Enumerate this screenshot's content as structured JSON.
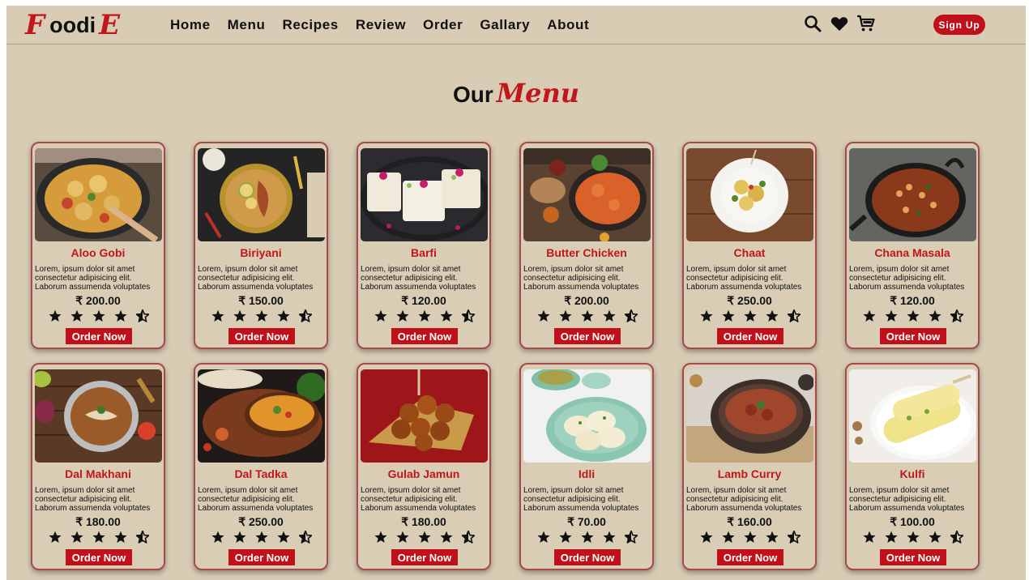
{
  "brand": {
    "first": "F",
    "middle": "oodi",
    "last": "E"
  },
  "nav": {
    "links": [
      "Home",
      "Menu",
      "Recipes",
      "Review",
      "Order",
      "Gallary",
      "About"
    ],
    "icons": [
      "search-icon",
      "heart-icon",
      "cart-icon"
    ],
    "signup_label": "Sign Up"
  },
  "section": {
    "title_plain": "Our",
    "title_accent": "Menu"
  },
  "colors": {
    "background": "#d8ccb4",
    "accent": "#c0161c",
    "button": "#c0101a",
    "card_border": "#a5494a"
  },
  "menu": {
    "items": [
      {
        "name": "Aloo Gobi",
        "desc": [
          "Lorem, ipsum dolor sit amet",
          "consectetur adipisicing elit.",
          "Laborum assumenda voluptates"
        ],
        "price": "₹ 200.00",
        "rating": 4.5,
        "order_label": "Order Now",
        "image": "aloo-gobi-image"
      },
      {
        "name": "Biriyani",
        "desc": [
          "Lorem, ipsum dolor sit amet",
          "consectetur adipisicing elit.",
          "Laborum assumenda voluptates"
        ],
        "price": "₹ 150.00",
        "rating": 4.5,
        "order_label": "Order Now",
        "image": "biriyani-image"
      },
      {
        "name": "Barfi",
        "desc": [
          "Lorem, ipsum dolor sit amet",
          "consectetur adipisicing elit.",
          "Laborum assumenda voluptates"
        ],
        "price": "₹ 120.00",
        "rating": 4.5,
        "order_label": "Order Now",
        "image": "barfi-image"
      },
      {
        "name": "Butter Chicken",
        "desc": [
          "Lorem, ipsum dolor sit amet",
          "consectetur adipisicing elit.",
          "Laborum assumenda voluptates"
        ],
        "price": "₹ 200.00",
        "rating": 4.5,
        "order_label": "Order Now",
        "image": "butter-chicken-image"
      },
      {
        "name": "Chaat",
        "desc": [
          "Lorem, ipsum dolor sit amet",
          "consectetur adipisicing elit.",
          "Laborum assumenda voluptates"
        ],
        "price": "₹ 250.00",
        "rating": 4.5,
        "order_label": "Order Now",
        "image": "chaat-image"
      },
      {
        "name": "Chana Masala",
        "desc": [
          "Lorem, ipsum dolor sit amet",
          "consectetur adipisicing elit.",
          "Laborum assumenda voluptates"
        ],
        "price": "₹ 120.00",
        "rating": 4.5,
        "order_label": "Order Now",
        "image": "chana-masala-image"
      },
      {
        "name": "Dal Makhani",
        "desc": [
          "Lorem, ipsum dolor sit amet",
          "consectetur adipisicing elit.",
          "Laborum assumenda voluptates"
        ],
        "price": "₹ 180.00",
        "rating": 4.5,
        "order_label": "Order Now",
        "image": "dal-makhani-image"
      },
      {
        "name": "Dal Tadka",
        "desc": [
          "Lorem, ipsum dolor sit amet",
          "consectetur adipisicing elit.",
          "Laborum assumenda voluptates"
        ],
        "price": "₹ 250.00",
        "rating": 4.5,
        "order_label": "Order Now",
        "image": "dal-tadka-image"
      },
      {
        "name": "Gulab Jamun",
        "desc": [
          "Lorem, ipsum dolor sit amet",
          "consectetur adipisicing elit.",
          "Laborum assumenda voluptates"
        ],
        "price": "₹ 180.00",
        "rating": 4.5,
        "order_label": "Order Now",
        "image": "gulab-jamun-image"
      },
      {
        "name": "Idli",
        "desc": [
          "Lorem, ipsum dolor sit amet",
          "consectetur adipisicing elit.",
          "Laborum assumenda voluptates"
        ],
        "price": "₹ 70.00",
        "rating": 4.5,
        "order_label": "Order Now",
        "image": "idli-image"
      },
      {
        "name": "Lamb Curry",
        "desc": [
          "Lorem, ipsum dolor sit amet",
          "consectetur adipisicing elit.",
          "Laborum assumenda voluptates"
        ],
        "price": "₹ 160.00",
        "rating": 4.5,
        "order_label": "Order Now",
        "image": "lamb-curry-image"
      },
      {
        "name": "Kulfi",
        "desc": [
          "Lorem, ipsum dolor sit amet",
          "consectetur adipisicing elit.",
          "Laborum assumenda voluptates"
        ],
        "price": "₹ 100.00",
        "rating": 4.5,
        "order_label": "Order Now",
        "image": "kulfi-image"
      }
    ]
  }
}
